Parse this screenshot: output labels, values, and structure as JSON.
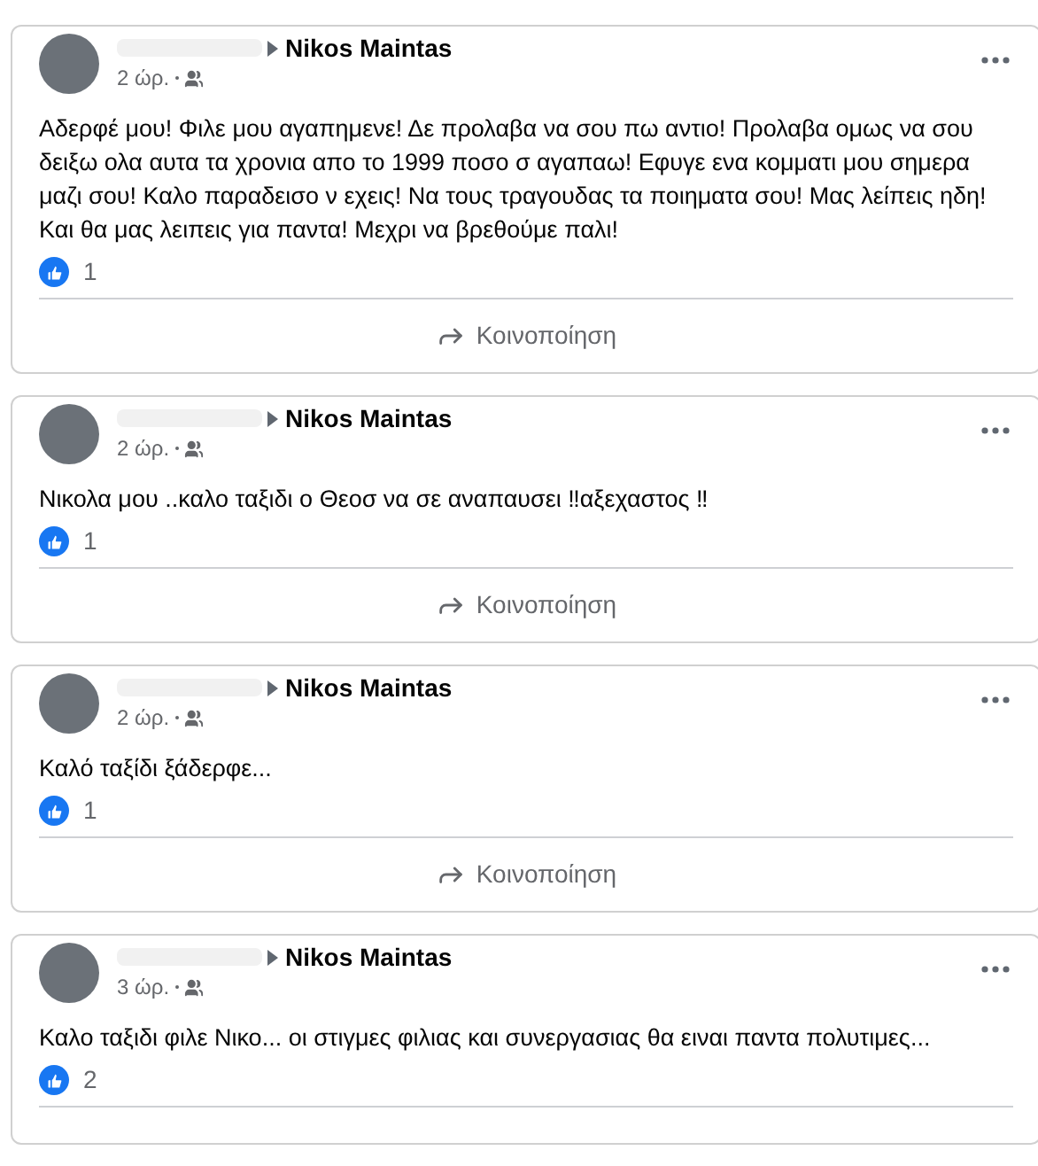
{
  "posts": [
    {
      "recipient": "Nikos Maintas",
      "time": "2 ώρ.",
      "text": "Αδερφέ μου! Φιλε μου αγαπημενε! Δε προλαβα να σου πω αντιο! Προλαβα ομως να σου δειξω ολα αυτα τα χρονια απο το 1999 ποσο σ αγαπαω! Εφυγε ενα κομματι μου σημερα μαζι σου! Καλο παραδεισο ν εχεις! Να τους τραγουδας τα ποιηματα σου! Μας λείπεις ηδη! Και θα μας λειπεις για παντα! Μεχρι να βρεθούμε παλι!",
      "likes": "1",
      "share": "Κοινοποίηση"
    },
    {
      "recipient": "Nikos Maintas",
      "time": "2 ώρ.",
      "text": "Νικολα μου ..καλο ταξιδι ο Θεοσ να σε αναπαυσει ‼αξεχαστος ‼",
      "likes": "1",
      "share": "Κοινοποίηση"
    },
    {
      "recipient": "Nikos Maintas",
      "time": "2 ώρ.",
      "text": "Καλό ταξίδι ξάδερφε...",
      "likes": "1",
      "share": "Κοινοποίηση"
    },
    {
      "recipient": "Nikos Maintas",
      "time": "3 ώρ.",
      "text": "Καλο ταξιδι φιλε Νικο... οι στιγμες φιλιας και συνεργασιας θα ειναι παντα πολυτιμες...",
      "likes": "2"
    }
  ]
}
